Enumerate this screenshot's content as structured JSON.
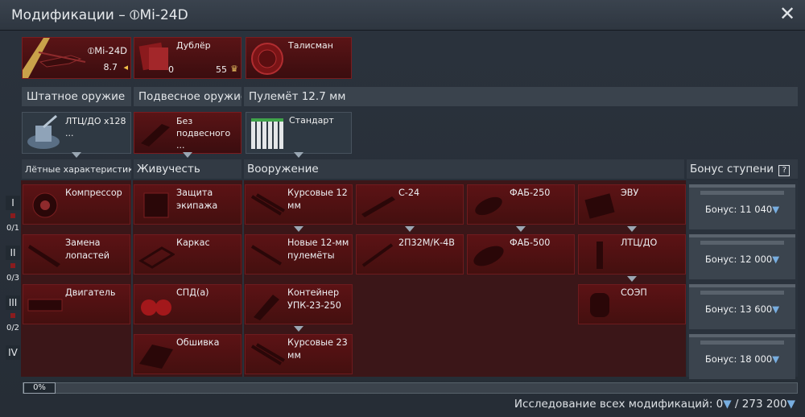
{
  "window": {
    "title": "Модификации – ⦶Mi-24D"
  },
  "slots": {
    "vehicle": {
      "name": "⦶Mi-24D",
      "br": "8.7"
    },
    "crew": {
      "label": "Дублёр",
      "left_value": "0",
      "right_value": "55"
    },
    "talisman": {
      "label": "Талисман"
    }
  },
  "weapon_row": {
    "headers": [
      "Штатное оружие",
      "Подвесное оружие",
      "Пулемёт 12.7 мм"
    ],
    "cards": [
      {
        "label": "ЛТЦ/ДО х128 ..."
      },
      {
        "label": "Без подвесного ..."
      },
      {
        "label": "Стандарт"
      }
    ]
  },
  "categories": {
    "flight": "Лётные характеристики",
    "survivability": "Живучесть",
    "armament": "Вооружение",
    "bonus": "Бонус ступени",
    "bonus_help": "?"
  },
  "tiers": [
    {
      "numeral": "I",
      "count": "0/1"
    },
    {
      "numeral": "II",
      "count": "0/3"
    },
    {
      "numeral": "III",
      "count": "0/2"
    },
    {
      "numeral": "IV",
      "count": ""
    }
  ],
  "mods": {
    "flight": [
      "Компрессор",
      "Замена лопастей",
      "Двигатель"
    ],
    "survivability": [
      "Защита экипажа",
      "Каркас",
      "СПД(а)",
      "Обшивка"
    ],
    "armament_col1": [
      "Курсовые 12 мм",
      "Новые 12-мм пулемёты",
      "Контейнер УПК-23-250",
      "Курсовые 23 мм"
    ],
    "armament_col2": [
      "С-24",
      "2П32М/К-4В"
    ],
    "armament_col3": [
      "ФАБ-250",
      "ФАБ-500"
    ],
    "armament_col4": [
      "ЭВУ",
      "ЛТЦ/ДО",
      "СОЭП"
    ]
  },
  "bonuses": [
    "Бонус: 11 040",
    "Бонус: 12 000",
    "Бонус: 13 600",
    "Бонус: 18 000"
  ],
  "progress": {
    "percent_label": "0%",
    "fraction": 0
  },
  "footer": {
    "text": "Исследование всех модификаций: 0",
    "total": " / 273 200"
  },
  "colors": {
    "mod_bg": "#5c1215",
    "accent_gem": "#78aee0"
  }
}
